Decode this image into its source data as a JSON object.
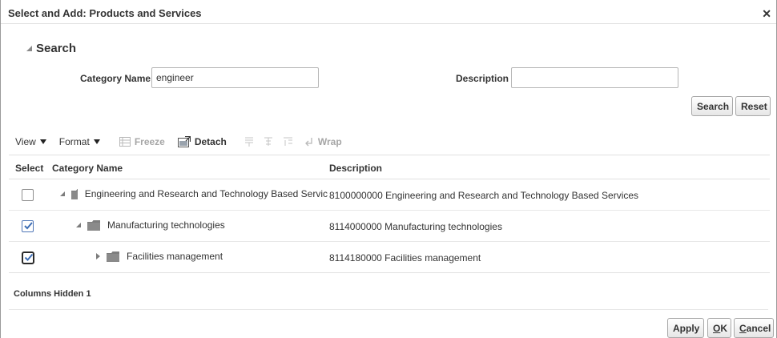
{
  "dialog": {
    "title": "Select and Add: Products and Services",
    "close_icon": "close-icon"
  },
  "search": {
    "header": "Search",
    "category_name_label": "Category Name",
    "category_name_value": "engineer",
    "description_label": "Description",
    "description_value": "",
    "search_button": "Search",
    "reset_button": "Reset"
  },
  "toolbar": {
    "view_label": "View",
    "format_label": "Format",
    "freeze_label": "Freeze",
    "detach_label": "Detach",
    "wrap_label": "Wrap",
    "icons": [
      "freeze-icon",
      "detach-icon",
      "freeze-column-icon",
      "freeze-row-icon",
      "expand-icon",
      "wrap-icon"
    ]
  },
  "table": {
    "columns": [
      "Select",
      "Category Name",
      "Description"
    ],
    "rows": [
      {
        "checked": false,
        "expanded": true,
        "level": 0,
        "category_name": "Engineering and Research and Technology Based Servic",
        "description": "8100000000 Engineering and Research and Technology Based Services"
      },
      {
        "checked": true,
        "expanded": true,
        "level": 1,
        "category_name": "Manufacturing technologies",
        "description": "8114000000 Manufacturing technologies"
      },
      {
        "checked": true,
        "expanded": false,
        "level": 2,
        "category_name": "Facilities management",
        "description": "8114180000 Facilities management"
      }
    ],
    "columns_hidden_label": "Columns Hidden",
    "columns_hidden_count": "1"
  },
  "actions": {
    "apply_button": "Apply",
    "ok_button_first": "O",
    "ok_button_rest": "K",
    "cancel_button_first": "C",
    "cancel_button_rest": "ancel"
  },
  "colors": {
    "checkbox_accent": "#4f76b7",
    "border": "#a8a8a8"
  }
}
